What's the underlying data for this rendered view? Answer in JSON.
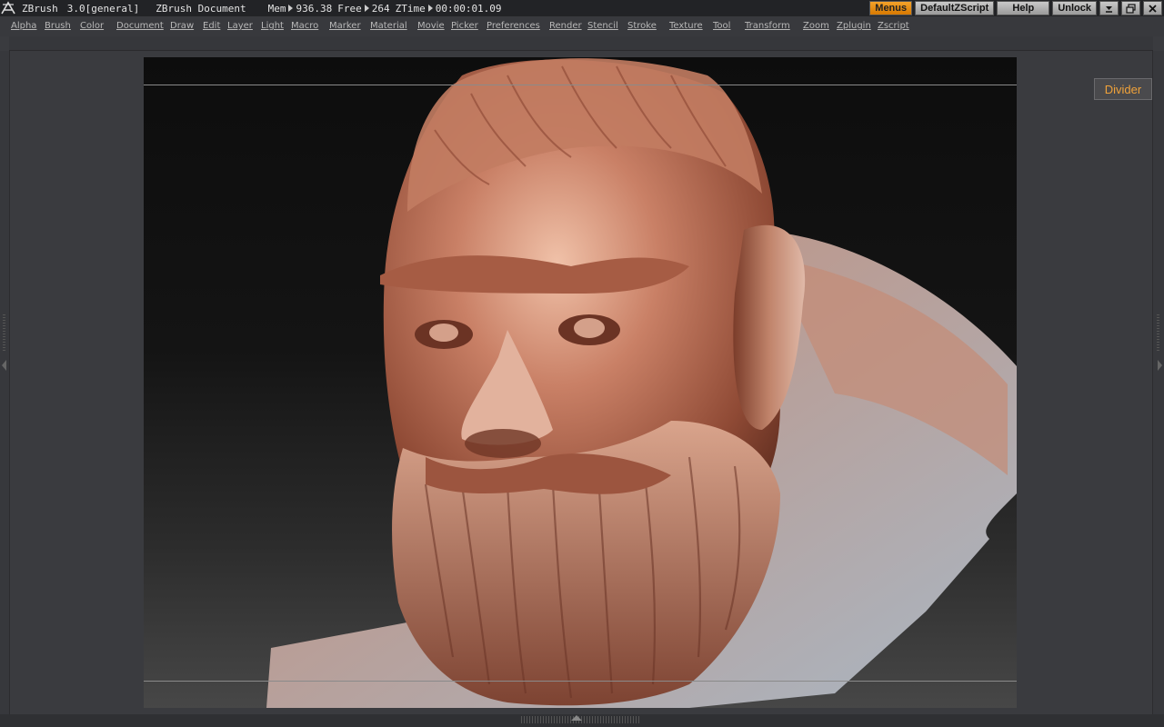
{
  "title_bar": {
    "app_name": "ZBrush",
    "version": "3.0[general]",
    "document": "ZBrush Document",
    "mem_label": "Mem",
    "mem_value": "936.38",
    "free_label": "Free",
    "free_value": "264",
    "ztime_label": "ZTime",
    "ztime_value": "00:00:01.09",
    "buttons": {
      "menus": "Menus",
      "script": "DefaultZScript",
      "help": "Help",
      "unlock": "Unlock"
    }
  },
  "menu_bar": {
    "items": [
      "Alpha",
      "Brush",
      "Color",
      "Document",
      "Draw",
      "Edit",
      "Layer",
      "Light",
      "Macro",
      "Marker",
      "Material",
      "Movie",
      "Picker",
      "Preferences",
      "Render",
      "Stencil",
      "Stroke",
      "Texture",
      "Tool",
      "Transform",
      "Zoom",
      "Zplugin",
      "Zscript"
    ]
  },
  "right_shelf": {
    "divider_label": "Divider"
  },
  "icons": {
    "logo": "zbrush-logo-icon",
    "minimize": "collapse-icon",
    "restore": "restore-window-icon",
    "close": "close-icon"
  },
  "colors": {
    "accent": "#e48a10",
    "sculpt_clay": "#b86a50"
  }
}
